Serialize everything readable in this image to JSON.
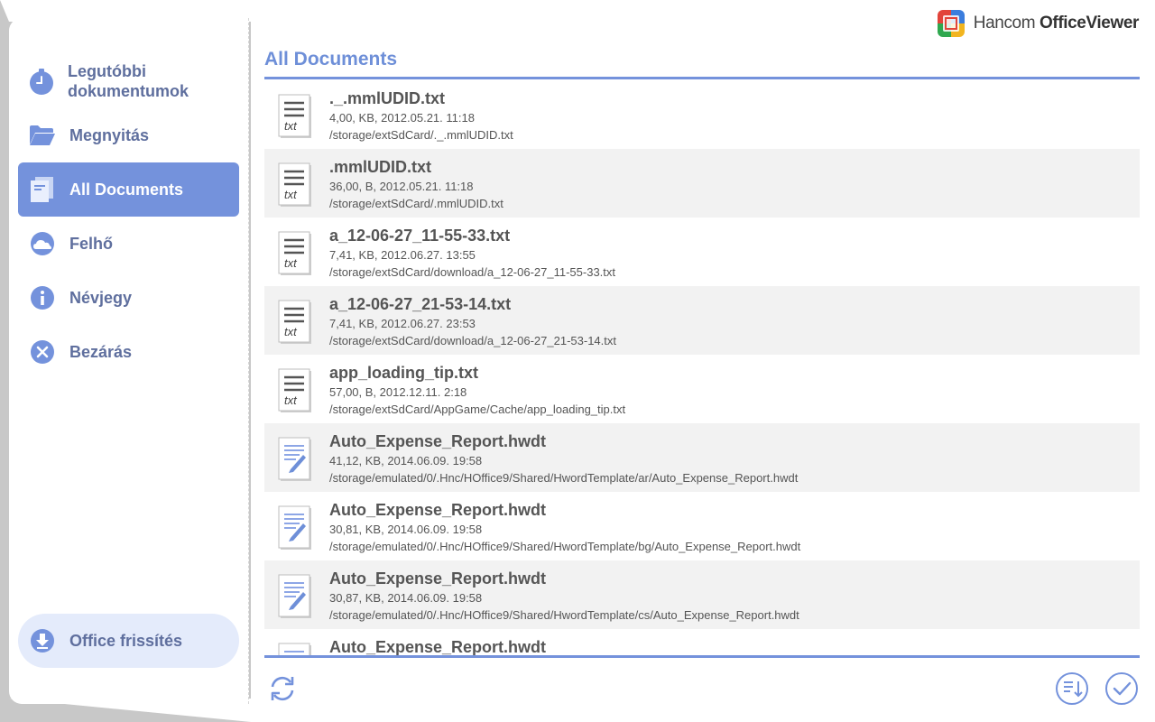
{
  "brand": {
    "name_regular": "Hancom ",
    "name_bold": "OfficeViewer"
  },
  "sidebar": {
    "items": [
      {
        "label": "Legutóbbi dokumentumok",
        "icon": "clock-icon"
      },
      {
        "label": "Megnyitás",
        "icon": "folder-open-icon"
      },
      {
        "label": "All Documents",
        "icon": "documents-icon",
        "active": true
      },
      {
        "label": "Felhő",
        "icon": "cloud-icon"
      },
      {
        "label": "Névjegy",
        "icon": "info-icon"
      },
      {
        "label": "Bezárás",
        "icon": "close-circle-icon"
      }
    ],
    "update_label": "Office frissítés",
    "update_icon": "download-icon"
  },
  "main": {
    "title": "All Documents",
    "files": [
      {
        "name": "._.mmlUDID.txt",
        "meta": "4,00, KB, 2012.05.21. 11:18",
        "path": "/storage/extSdCard/._.mmlUDID.txt",
        "type": "txt",
        "type_label": "txt"
      },
      {
        "name": ".mmlUDID.txt",
        "meta": "36,00, B, 2012.05.21. 11:18",
        "path": "/storage/extSdCard/.mmlUDID.txt",
        "type": "txt",
        "type_label": "txt"
      },
      {
        "name": "a_12-06-27_11-55-33.txt",
        "meta": "7,41, KB, 2012.06.27. 13:55",
        "path": "/storage/extSdCard/download/a_12-06-27_11-55-33.txt",
        "type": "txt",
        "type_label": "txt"
      },
      {
        "name": "a_12-06-27_21-53-14.txt",
        "meta": "7,41, KB, 2012.06.27. 23:53",
        "path": "/storage/extSdCard/download/a_12-06-27_21-53-14.txt",
        "type": "txt",
        "type_label": "txt"
      },
      {
        "name": "app_loading_tip.txt",
        "meta": "57,00, B, 2012.12.11. 2:18",
        "path": "/storage/extSdCard/AppGame/Cache/app_loading_tip.txt",
        "type": "txt",
        "type_label": "txt"
      },
      {
        "name": "Auto_Expense_Report.hwdt",
        "meta": "41,12, KB, 2014.06.09. 19:58",
        "path": "/storage/emulated/0/.Hnc/HOffice9/Shared/HwordTemplate/ar/Auto_Expense_Report.hwdt",
        "type": "hwdt"
      },
      {
        "name": "Auto_Expense_Report.hwdt",
        "meta": "30,81, KB, 2014.06.09. 19:58",
        "path": "/storage/emulated/0/.Hnc/HOffice9/Shared/HwordTemplate/bg/Auto_Expense_Report.hwdt",
        "type": "hwdt"
      },
      {
        "name": "Auto_Expense_Report.hwdt",
        "meta": "30,87, KB, 2014.06.09. 19:58",
        "path": "/storage/emulated/0/.Hnc/HOffice9/Shared/HwordTemplate/cs/Auto_Expense_Report.hwdt",
        "type": "hwdt"
      },
      {
        "name": "Auto_Expense_Report.hwdt",
        "meta": "",
        "path": "",
        "type": "hwdt"
      }
    ]
  },
  "toolbar": {
    "refresh_icon": "refresh-icon",
    "sort_icon": "sort-icon",
    "select_icon": "check-circle-icon"
  },
  "colors": {
    "accent": "#7492dc",
    "menu_text": "#5f6f9e",
    "title": "#6e8fd8",
    "row_alt": "#f2f2f2"
  }
}
